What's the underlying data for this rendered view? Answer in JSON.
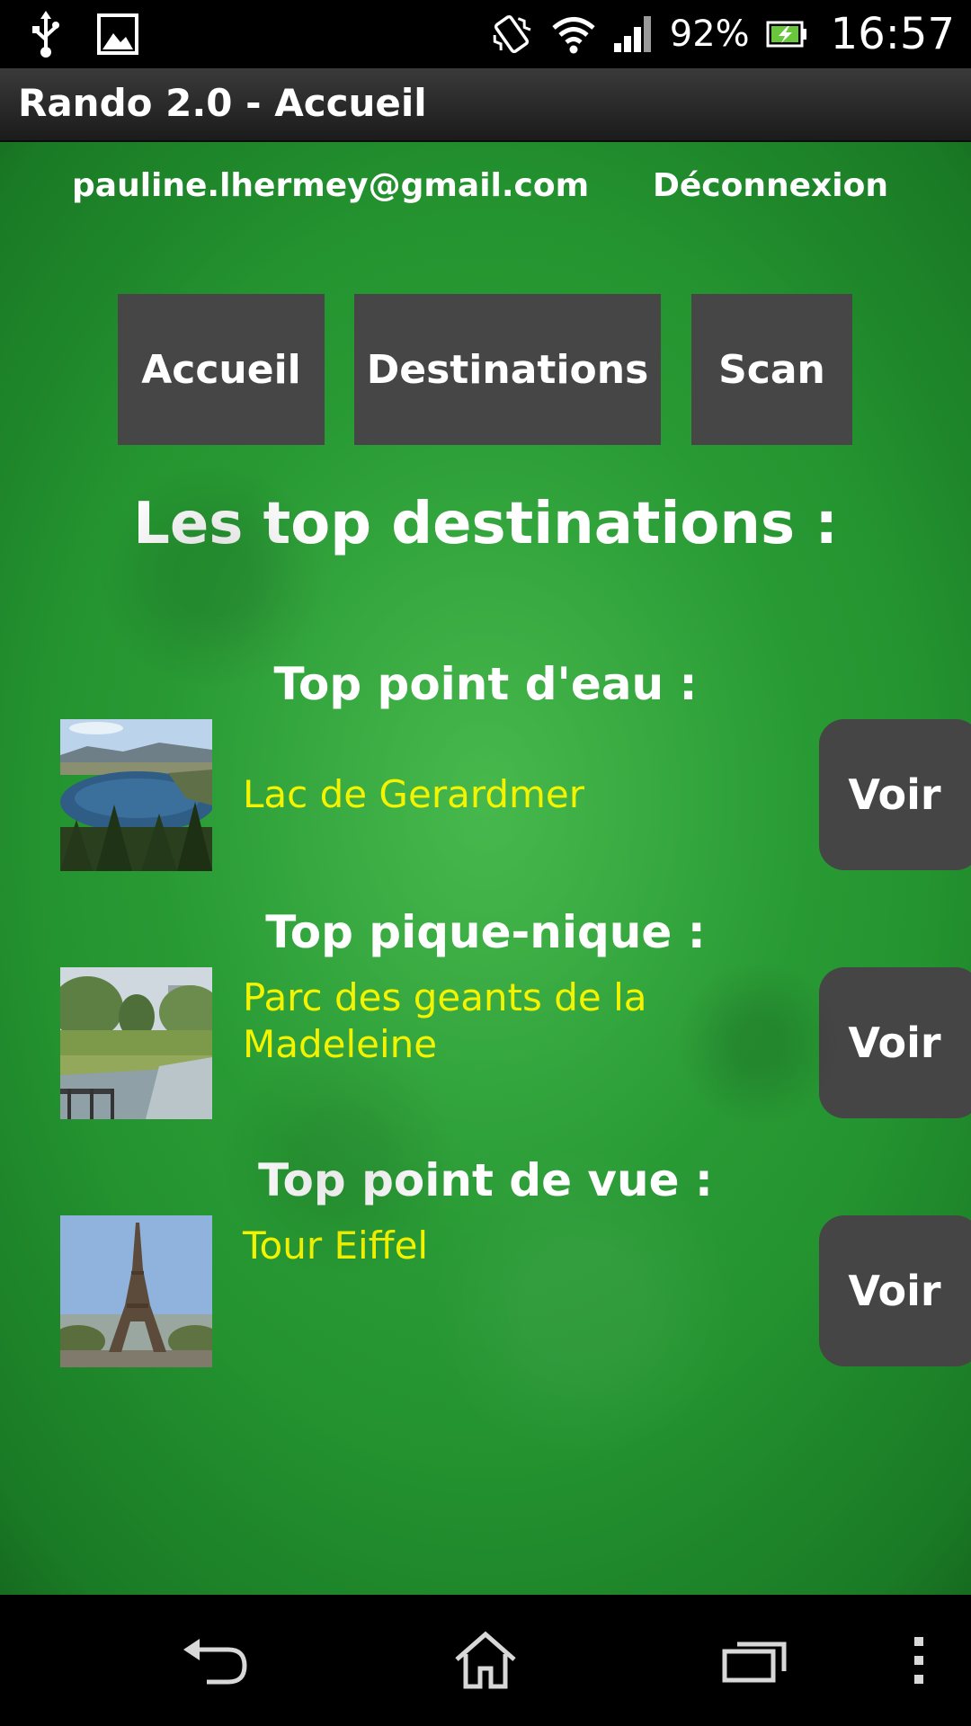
{
  "status_bar": {
    "battery_percent": "92%",
    "time": "16:57",
    "icons": [
      "usb-icon",
      "image-notification-icon",
      "vibrate-icon",
      "wifi-icon",
      "signal-icon",
      "battery-charging-icon"
    ]
  },
  "app": {
    "title": "Rando 2.0 - Accueil"
  },
  "header": {
    "email": "pauline.lhermey@gmail.com",
    "logout_label": "Déconnexion"
  },
  "nav": {
    "accueil": "Accueil",
    "destinations": "Destinations",
    "scan": "Scan"
  },
  "main": {
    "heading": "Les top destinations :",
    "sections": [
      {
        "category": "Top point d'eau :",
        "name": "Lac de Gerardmer",
        "button": "Voir",
        "thumb_icon": "lake-photo"
      },
      {
        "category": "Top pique-nique :",
        "name": "Parc des geants de la Madeleine",
        "button": "Voir",
        "thumb_icon": "park-photo"
      },
      {
        "category": "Top point de vue :",
        "name": "Tour Eiffel",
        "button": "Voir",
        "thumb_icon": "eiffel-tower-photo"
      }
    ]
  },
  "system_nav": {
    "icons": [
      "back-icon",
      "home-icon",
      "recent-apps-icon",
      "overflow-menu-icon"
    ]
  },
  "colors": {
    "destination_text": "#f4f400",
    "button_bg": "#464646",
    "background_green": "#2f9f3c"
  }
}
